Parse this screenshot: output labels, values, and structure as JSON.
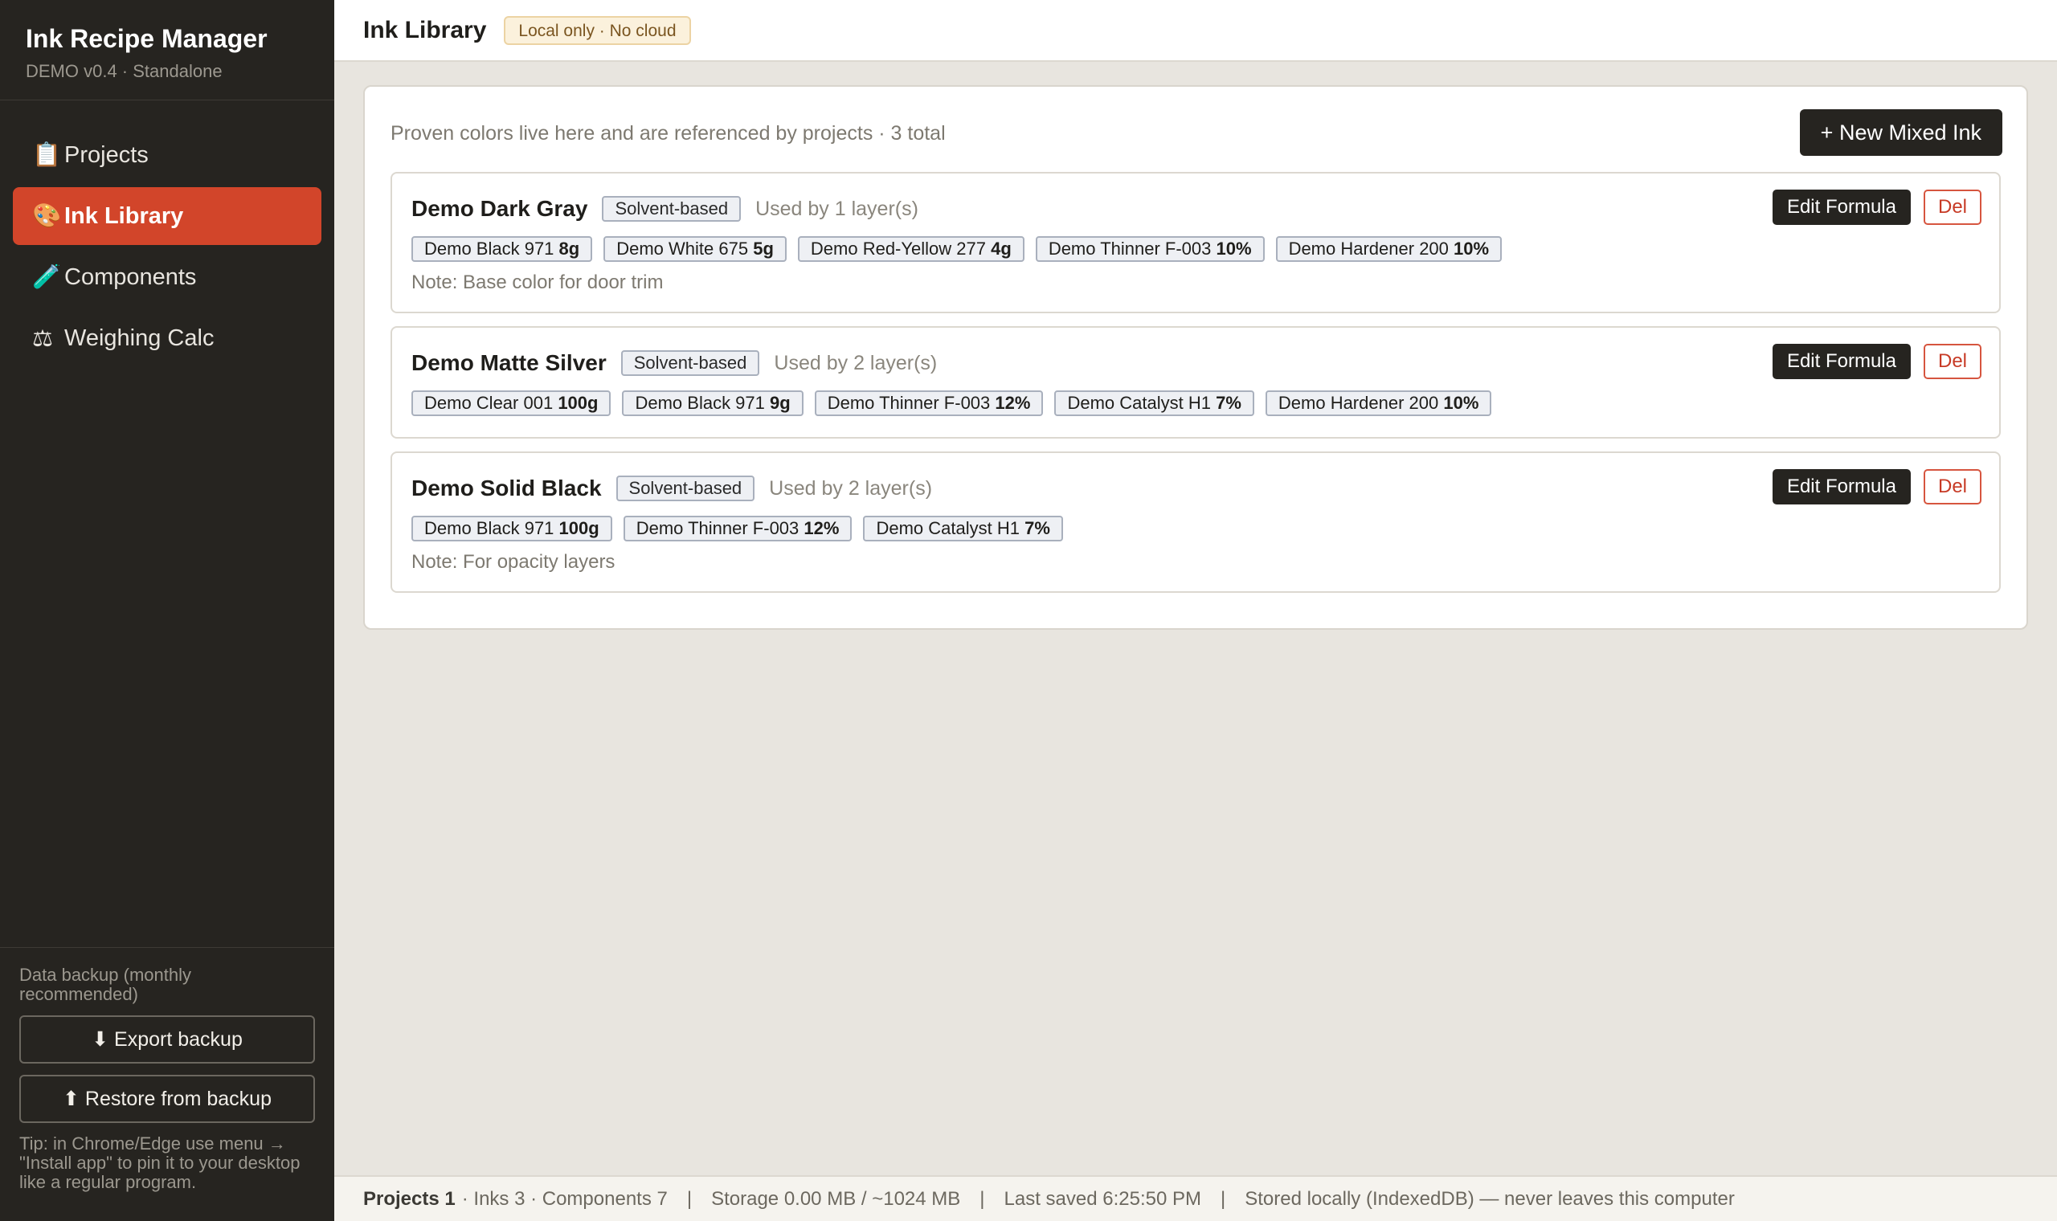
{
  "app": {
    "title": "Ink Recipe Manager",
    "subtitle": "DEMO v0.4 · Standalone"
  },
  "nav": [
    {
      "icon": "📋",
      "icon_name": "clipboard-icon",
      "label": "Projects",
      "active": false
    },
    {
      "icon": "🎨",
      "icon_name": "palette-icon",
      "label": "Ink Library",
      "active": true
    },
    {
      "icon": "🧪",
      "icon_name": "test-tube-icon",
      "label": "Components",
      "active": false
    },
    {
      "icon": "⚖",
      "icon_name": "scale-icon",
      "label": "Weighing Calc",
      "active": false
    }
  ],
  "backup": {
    "label": "Data backup (monthly recommended)",
    "export_label": "⬇ Export backup",
    "restore_label": "⬆ Restore from backup",
    "tip": "Tip: in Chrome/Edge use menu → \"Install app\" to pin it to your desktop like a regular program."
  },
  "header": {
    "title": "Ink Library",
    "badge": "Local only · No cloud"
  },
  "library": {
    "description": "Proven colors live here and are referenced by projects · 3 total",
    "new_button": "+ New Mixed Ink",
    "edit_label": "Edit Formula",
    "delete_label": "Del",
    "inks": [
      {
        "name": "Demo Dark Gray",
        "base": "Solvent-based",
        "used_by": "Used by 1 layer(s)",
        "components": [
          {
            "name": "Demo Black 971",
            "amount": "8g"
          },
          {
            "name": "Demo White 675",
            "amount": "5g"
          },
          {
            "name": "Demo Red-Yellow 277",
            "amount": "4g"
          },
          {
            "name": "Demo Thinner F-003",
            "amount": "10%"
          },
          {
            "name": "Demo Hardener 200",
            "amount": "10%"
          }
        ],
        "note": "Note: Base color for door trim"
      },
      {
        "name": "Demo Matte Silver",
        "base": "Solvent-based",
        "used_by": "Used by 2 layer(s)",
        "components": [
          {
            "name": "Demo Clear 001",
            "amount": "100g"
          },
          {
            "name": "Demo Black 971",
            "amount": "9g"
          },
          {
            "name": "Demo Thinner F-003",
            "amount": "12%"
          },
          {
            "name": "Demo Catalyst H1",
            "amount": "7%"
          },
          {
            "name": "Demo Hardener 200",
            "amount": "10%"
          }
        ],
        "note": ""
      },
      {
        "name": "Demo Solid Black",
        "base": "Solvent-based",
        "used_by": "Used by 2 layer(s)",
        "components": [
          {
            "name": "Demo Black 971",
            "amount": "100g"
          },
          {
            "name": "Demo Thinner F-003",
            "amount": "12%"
          },
          {
            "name": "Demo Catalyst H1",
            "amount": "7%"
          }
        ],
        "note": "Note: For opacity layers"
      }
    ]
  },
  "status": {
    "projects": "Projects 1",
    "counts": "· Inks 3 · Components 7",
    "separator": "|",
    "storage": "Storage 0.00 MB / ~1024 MB",
    "last_saved": "Last saved 6:25:50 PM",
    "stored": "Stored locally (IndexedDB) — never leaves this computer"
  },
  "colors": {
    "sidebar_bg": "#262420",
    "accent": "#d2452a",
    "danger": "#c73a25",
    "badge_bg": "#fbf1dc"
  }
}
